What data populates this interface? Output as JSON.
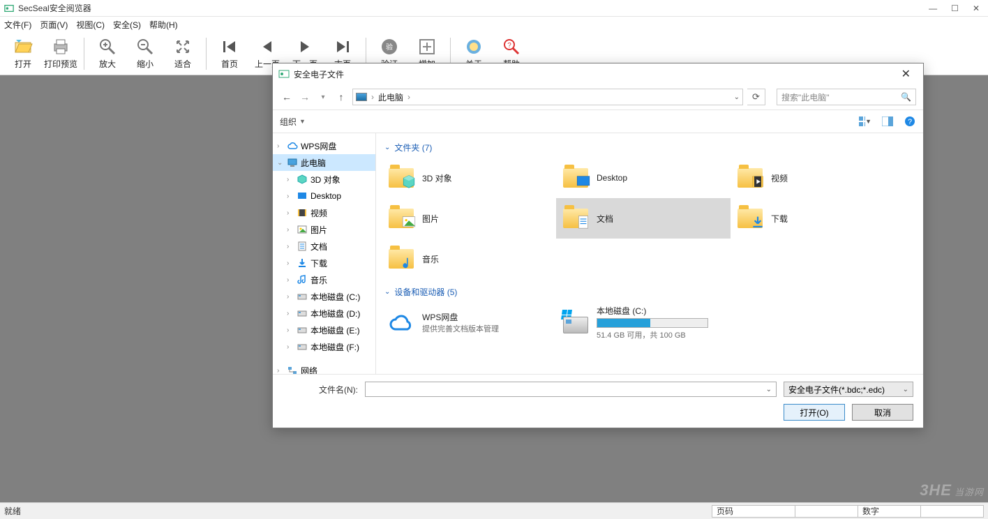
{
  "app": {
    "title": "SecSeal安全阅览器",
    "win_min": "—",
    "win_max": "☐",
    "win_close": "✕"
  },
  "menu": [
    "文件(F)",
    "页面(V)",
    "视图(C)",
    "安全(S)",
    "帮助(H)"
  ],
  "toolbar": {
    "groups": [
      [
        "打开",
        "打印预览"
      ],
      [
        "放大",
        "缩小",
        "适合"
      ],
      [
        "首页",
        "上一页",
        "下一页",
        "末页"
      ],
      [
        "验证",
        "增加"
      ],
      [
        "关于",
        "帮助"
      ]
    ]
  },
  "status": {
    "ready": "就绪",
    "page_label": "页码",
    "digits_label": "数字"
  },
  "watermark": {
    "logo": "3HE",
    "text": "当游网"
  },
  "dialog": {
    "title": "安全电子文件",
    "breadcrumb": [
      "此电脑"
    ],
    "search_placeholder": "搜索\"此电脑\"",
    "organize": "组织",
    "tree": [
      {
        "level": 1,
        "label": "WPS网盘",
        "expanded": false,
        "icon": "cloud",
        "selected": false
      },
      {
        "level": 1,
        "label": "此电脑",
        "expanded": true,
        "icon": "pc",
        "selected": true
      },
      {
        "level": 2,
        "label": "3D 对象",
        "icon": "cube"
      },
      {
        "level": 2,
        "label": "Desktop",
        "icon": "desktop"
      },
      {
        "level": 2,
        "label": "视频",
        "icon": "video"
      },
      {
        "level": 2,
        "label": "图片",
        "icon": "picture"
      },
      {
        "level": 2,
        "label": "文档",
        "icon": "document"
      },
      {
        "level": 2,
        "label": "下载",
        "icon": "download"
      },
      {
        "level": 2,
        "label": "音乐",
        "icon": "music"
      },
      {
        "level": 2,
        "label": "本地磁盘 (C:)",
        "icon": "disk"
      },
      {
        "level": 2,
        "label": "本地磁盘 (D:)",
        "icon": "disk"
      },
      {
        "level": 2,
        "label": "本地磁盘 (E:)",
        "icon": "disk"
      },
      {
        "level": 2,
        "label": "本地磁盘 (F:)",
        "icon": "disk"
      },
      {
        "level": 1,
        "label": "网络",
        "expanded": false,
        "icon": "network",
        "selected": false,
        "spacer": true
      }
    ],
    "sections": [
      {
        "header": "文件夹 (7)",
        "items": [
          {
            "title": "3D 对象",
            "icon": "cube"
          },
          {
            "title": "Desktop",
            "icon": "desktop"
          },
          {
            "title": "视频",
            "icon": "video"
          },
          {
            "title": "图片",
            "icon": "picture"
          },
          {
            "title": "文档",
            "icon": "document",
            "selected": true
          },
          {
            "title": "下载",
            "icon": "download"
          },
          {
            "title": "音乐",
            "icon": "music"
          }
        ]
      },
      {
        "header": "设备和驱动器 (5)",
        "items": [
          {
            "title": "WPS网盘",
            "subtitle": "提供完善文档版本管理",
            "icon": "cloud"
          },
          {
            "title": "本地磁盘 (C:)",
            "subtitle": "51.4 GB 可用，共 100 GB",
            "icon": "disk",
            "drive": true,
            "used_pct": 48
          }
        ]
      }
    ],
    "filename_label": "文件名(N):",
    "filename_value": "",
    "filter_value": "安全电子文件(*.bdc;*.edc)",
    "open_btn": "打开(O)",
    "cancel_btn": "取消"
  }
}
